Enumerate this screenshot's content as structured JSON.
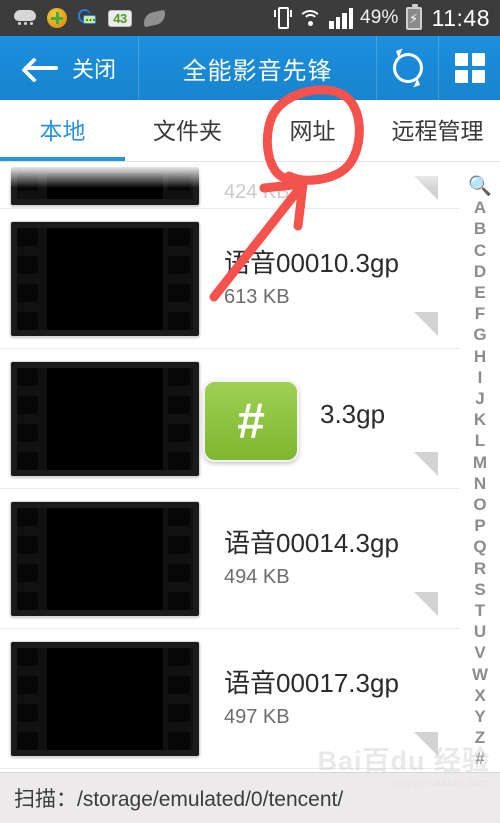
{
  "status_bar": {
    "icons_left": [
      "cloud-icon",
      "plus-circle-icon",
      "message-lock-icon",
      "badge-43-icon",
      "leaf-icon"
    ],
    "badge_value": "43",
    "icons_right": [
      "vibrate-icon",
      "wifi-icon",
      "signal-icon",
      "battery-icon"
    ],
    "battery_percent": "49%",
    "battery_glyph": "⚡",
    "time": "11:48"
  },
  "header": {
    "back_label": "关闭",
    "title": "全能影音先锋",
    "refresh_icon": "refresh-icon",
    "grid_icon": "grid-icon",
    "background_color": "#1784cf"
  },
  "tabs": {
    "items": [
      {
        "label": "本地",
        "active": true
      },
      {
        "label": "文件夹",
        "active": false
      },
      {
        "label": "网址",
        "active": false
      },
      {
        "label": "远程管理",
        "active": false
      }
    ],
    "active_color": "#2a93e0"
  },
  "list": {
    "partial_top": {
      "size": "424 KB"
    },
    "items": [
      {
        "name": "语音00010.3gp",
        "size": "613 KB",
        "thumb": "video-film-thumbnail"
      },
      {
        "name": "3.3gp",
        "size": "",
        "thumb": "video-film-thumbnail"
      },
      {
        "name": "语音00014.3gp",
        "size": "494 KB",
        "thumb": "video-film-thumbnail"
      },
      {
        "name": "语音00017.3gp",
        "size": "497 KB",
        "thumb": "video-film-thumbnail"
      }
    ]
  },
  "index_bar": {
    "search_icon": "search-icon",
    "letters": [
      "A",
      "B",
      "C",
      "D",
      "E",
      "F",
      "G",
      "H",
      "I",
      "J",
      "K",
      "L",
      "M",
      "N",
      "O",
      "P",
      "Q",
      "R",
      "S",
      "T",
      "U",
      "V",
      "W",
      "X",
      "Y",
      "Z",
      "#"
    ]
  },
  "hash_bubble": {
    "label": "#",
    "color": "#8cc23f"
  },
  "footer": {
    "text": "扫描：/storage/emulated/0/tencent/"
  },
  "watermark": {
    "main": "Bai百du 经验",
    "sub": "jingyan.baidu.com"
  },
  "annotation": {
    "color": "#f4534d",
    "target_tab": "网址",
    "shape": "ellipse-with-arrow"
  }
}
